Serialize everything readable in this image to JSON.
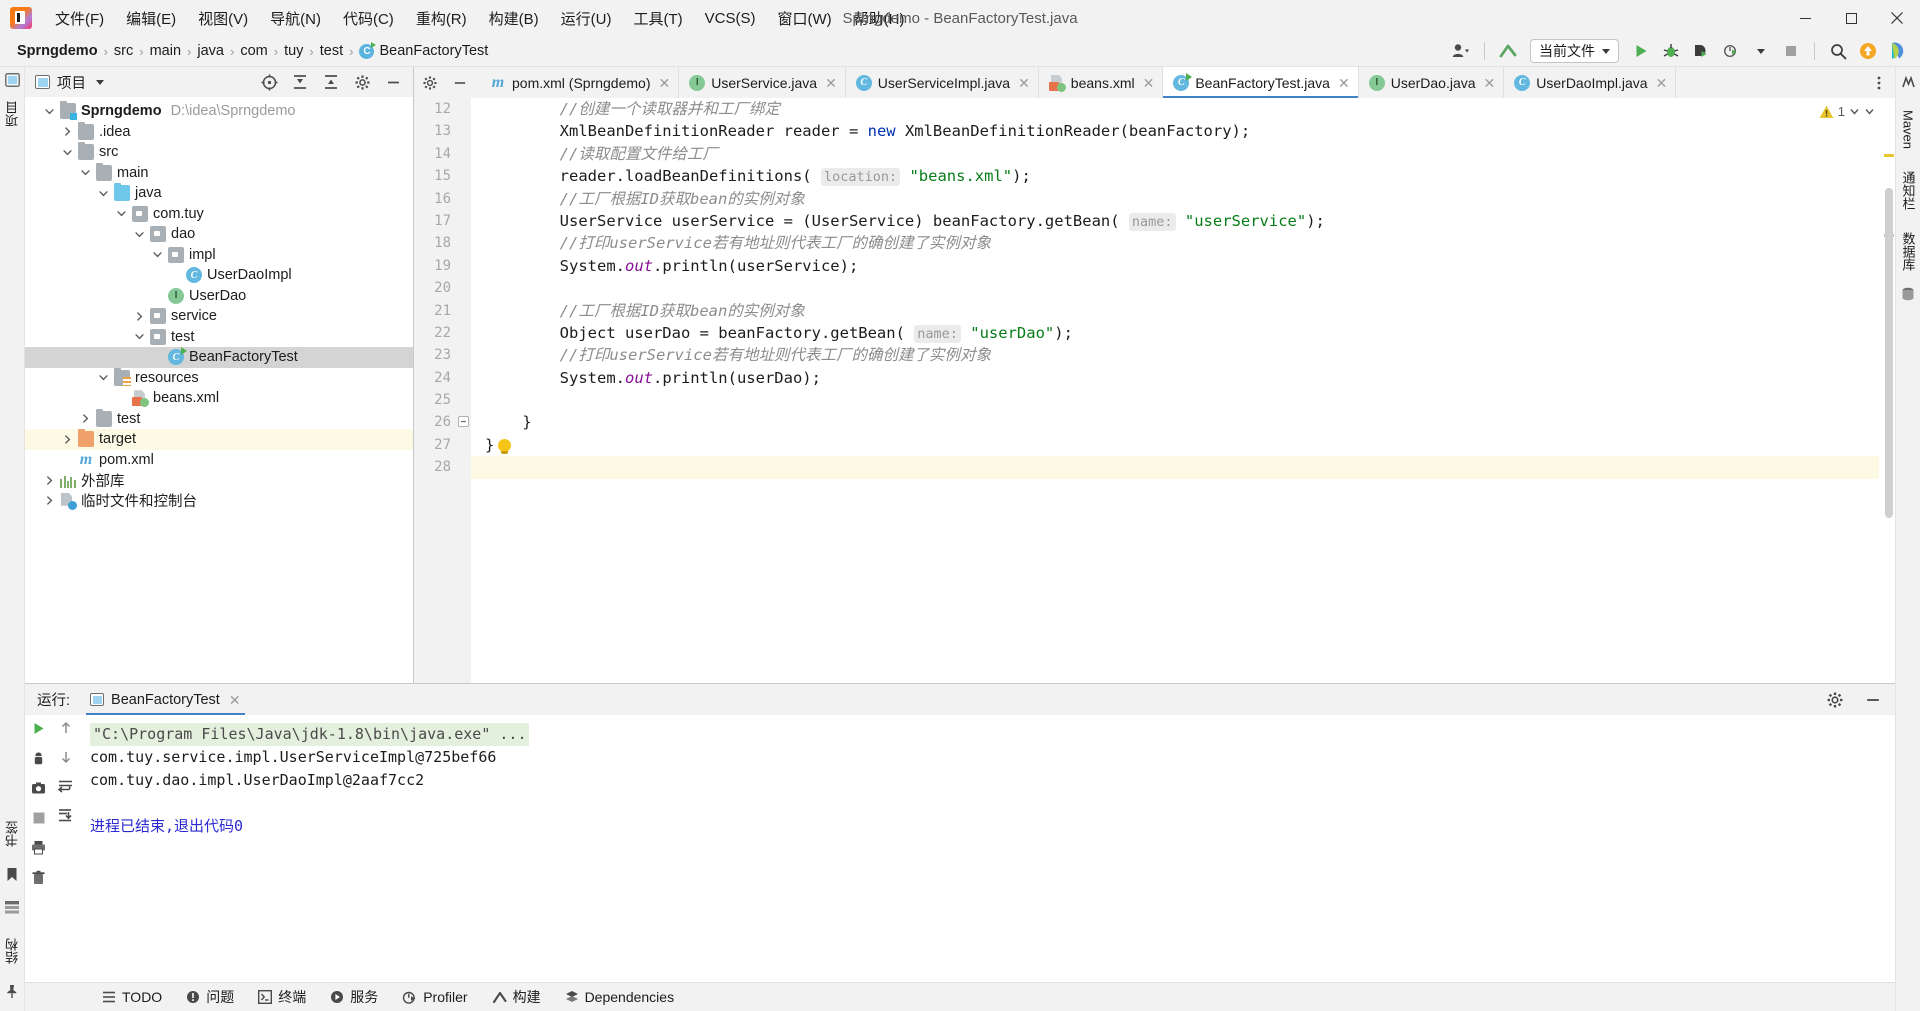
{
  "window": {
    "title": "Sprngdemo - BeanFactoryTest.java",
    "minimize": "minimize-button",
    "maximize": "maximize-button",
    "close": "close-button"
  },
  "menubar": {
    "items": [
      {
        "label": "文件(F)"
      },
      {
        "label": "编辑(E)"
      },
      {
        "label": "视图(V)"
      },
      {
        "label": "导航(N)"
      },
      {
        "label": "代码(C)"
      },
      {
        "label": "重构(R)"
      },
      {
        "label": "构建(B)"
      },
      {
        "label": "运行(U)"
      },
      {
        "label": "工具(T)"
      },
      {
        "label": "VCS(S)"
      },
      {
        "label": "窗口(W)"
      },
      {
        "label": "帮助(H)"
      }
    ]
  },
  "breadcrumb": {
    "items": [
      "Sprngdemo",
      "src",
      "main",
      "java",
      "com",
      "tuy",
      "test"
    ],
    "file": "BeanFactoryTest",
    "separator": "›"
  },
  "toolbar": {
    "run_config": "当前文件",
    "icons": [
      "user-avatar-icon",
      "updates-arrow-icon",
      "run-icon",
      "debug-icon",
      "run-coverage-icon",
      "profiler-icon",
      "stop-icon",
      "search-everywhere-icon",
      "update-project-icon",
      "ide-assistant-icon"
    ]
  },
  "project_panel": {
    "title": "项目",
    "header_icons": [
      "select-opened-file-icon",
      "expand-all-icon",
      "collapse-all-icon",
      "settings-icon",
      "hide-icon"
    ],
    "tree": [
      {
        "depth": 0,
        "label": "Sprngdemo",
        "path": "D:\\idea\\Sprngdemo",
        "icon": "module-root-icon",
        "arrow": "down",
        "bold": true
      },
      {
        "depth": 1,
        "label": ".idea",
        "icon": "folder-icon",
        "arrow": "right"
      },
      {
        "depth": 1,
        "label": "src",
        "icon": "folder-icon",
        "arrow": "down"
      },
      {
        "depth": 2,
        "label": "main",
        "icon": "folder-icon",
        "arrow": "down"
      },
      {
        "depth": 3,
        "label": "java",
        "icon": "source-folder-icon",
        "arrow": "down"
      },
      {
        "depth": 4,
        "label": "com.tuy",
        "icon": "package-icon",
        "arrow": "down"
      },
      {
        "depth": 5,
        "label": "dao",
        "icon": "package-icon",
        "arrow": "down"
      },
      {
        "depth": 6,
        "label": "impl",
        "icon": "package-icon",
        "arrow": "down"
      },
      {
        "depth": 7,
        "label": "UserDaoImpl",
        "icon": "class-icon",
        "arrow": "none"
      },
      {
        "depth": 6,
        "label": "UserDao",
        "icon": "interface-icon",
        "arrow": "none"
      },
      {
        "depth": 5,
        "label": "service",
        "icon": "package-icon",
        "arrow": "right"
      },
      {
        "depth": 5,
        "label": "test",
        "icon": "package-icon",
        "arrow": "down"
      },
      {
        "depth": 6,
        "label": "BeanFactoryTest",
        "icon": "runnable-class-icon",
        "arrow": "none",
        "selected": true
      },
      {
        "depth": 3,
        "label": "resources",
        "icon": "resources-folder-icon",
        "arrow": "down"
      },
      {
        "depth": 4,
        "label": "beans.xml",
        "icon": "spring-xml-icon",
        "arrow": "none"
      },
      {
        "depth": 2,
        "label": "test",
        "icon": "folder-icon",
        "arrow": "right"
      },
      {
        "depth": 1,
        "label": "target",
        "icon": "excluded-folder-icon",
        "arrow": "right",
        "highlight": true
      },
      {
        "depth": 1,
        "label": "pom.xml",
        "icon": "maven-icon",
        "arrow": "none"
      },
      {
        "depth": 0,
        "label": "外部库",
        "icon": "external-libraries-icon",
        "arrow": "right"
      },
      {
        "depth": 0,
        "label": "临时文件和控制台",
        "icon": "scratches-icon",
        "arrow": "right"
      }
    ]
  },
  "editor": {
    "tabs": [
      {
        "label": "pom.xml (Sprngdemo)",
        "icon": "maven-icon",
        "active": false
      },
      {
        "label": "UserService.java",
        "icon": "interface-icon",
        "active": false
      },
      {
        "label": "UserServiceImpl.java",
        "icon": "class-icon",
        "active": false
      },
      {
        "label": "beans.xml",
        "icon": "spring-xml-icon",
        "active": false
      },
      {
        "label": "BeanFactoryTest.java",
        "icon": "runnable-class-icon",
        "active": true
      },
      {
        "label": "UserDao.java",
        "icon": "interface-icon",
        "active": false
      },
      {
        "label": "UserDaoImpl.java",
        "icon": "class-icon",
        "active": false
      }
    ],
    "warning_count": "1",
    "line_numbers": [
      "12",
      "13",
      "14",
      "15",
      "16",
      "17",
      "18",
      "19",
      "20",
      "21",
      "22",
      "23",
      "24",
      "25",
      "26",
      "27",
      "28"
    ],
    "lines": [
      {
        "n": "12",
        "tokens": [
          {
            "t": "        //创建一个读取器并和工厂绑定",
            "c": "cmt"
          }
        ]
      },
      {
        "n": "13",
        "tokens": [
          {
            "t": "        XmlBeanDefinitionReader reader = ",
            "c": ""
          },
          {
            "t": "new",
            "c": "kw"
          },
          {
            "t": " XmlBeanDefinitionReader(beanFactory);",
            "c": ""
          }
        ]
      },
      {
        "n": "14",
        "tokens": [
          {
            "t": "        //读取配置文件给工厂",
            "c": "cmt"
          }
        ]
      },
      {
        "n": "15",
        "tokens": [
          {
            "t": "        reader.loadBeanDefinitions( ",
            "c": ""
          },
          {
            "t": "location:",
            "c": "hint"
          },
          {
            "t": " ",
            "c": ""
          },
          {
            "t": "\"beans.xml\"",
            "c": "str"
          },
          {
            "t": ");",
            "c": ""
          }
        ]
      },
      {
        "n": "16",
        "tokens": [
          {
            "t": "        //工厂根据ID获取bean的实例对象",
            "c": "cmt"
          }
        ]
      },
      {
        "n": "17",
        "tokens": [
          {
            "t": "        UserService userService = (UserService) beanFactory.getBean( ",
            "c": ""
          },
          {
            "t": "name:",
            "c": "hint"
          },
          {
            "t": " ",
            "c": ""
          },
          {
            "t": "\"userService\"",
            "c": "str"
          },
          {
            "t": ");",
            "c": ""
          }
        ]
      },
      {
        "n": "18",
        "tokens": [
          {
            "t": "        //打印userService若有地址则代表工厂的确创建了实例对象",
            "c": "cmt"
          }
        ]
      },
      {
        "n": "19",
        "tokens": [
          {
            "t": "        System.",
            "c": ""
          },
          {
            "t": "out",
            "c": "fld"
          },
          {
            "t": ".println(userService);",
            "c": ""
          }
        ]
      },
      {
        "n": "20",
        "tokens": [
          {
            "t": "",
            "c": ""
          }
        ]
      },
      {
        "n": "21",
        "tokens": [
          {
            "t": "        //工厂根据ID获取bean的实例对象",
            "c": "cmt"
          }
        ]
      },
      {
        "n": "22",
        "tokens": [
          {
            "t": "        Object userDao = beanFactory.getBean( ",
            "c": ""
          },
          {
            "t": "name:",
            "c": "hint"
          },
          {
            "t": " ",
            "c": ""
          },
          {
            "t": "\"userDao\"",
            "c": "str"
          },
          {
            "t": ");",
            "c": ""
          }
        ]
      },
      {
        "n": "23",
        "tokens": [
          {
            "t": "        //打印userService若有地址则代表工厂的确创建了实例对象",
            "c": "cmt"
          }
        ]
      },
      {
        "n": "24",
        "tokens": [
          {
            "t": "        System.",
            "c": ""
          },
          {
            "t": "out",
            "c": "fld"
          },
          {
            "t": ".println(userDao);",
            "c": ""
          }
        ]
      },
      {
        "n": "25",
        "tokens": [
          {
            "t": "",
            "c": ""
          }
        ]
      },
      {
        "n": "26",
        "tokens": [
          {
            "t": "    }",
            "c": ""
          }
        ]
      },
      {
        "n": "27",
        "tokens": [
          {
            "t": "}",
            "c": ""
          }
        ]
      },
      {
        "n": "28",
        "tokens": [
          {
            "t": "",
            "c": ""
          }
        ]
      }
    ]
  },
  "run_panel": {
    "label": "运行:",
    "tab": "BeanFactoryTest",
    "gutter_icons": [
      "rerun-icon",
      "stop-icon",
      "camera-icon",
      "thread-dump-icon",
      "print-icon",
      "trash-icon",
      "up-icon",
      "down-icon",
      "soft-wrap-icon",
      "scroll-to-end-icon"
    ],
    "settings_icon": "settings-icon",
    "hide_icon": "hide-icon",
    "output": [
      {
        "text": "\"C:\\Program Files\\Java\\jdk-1.8\\bin\\java.exe\" ...",
        "style": "cmd"
      },
      {
        "text": "com.tuy.service.impl.UserServiceImpl@725bef66",
        "style": "plain"
      },
      {
        "text": "com.tuy.dao.impl.UserDaoImpl@2aaf7cc2",
        "style": "plain"
      },
      {
        "text": "",
        "style": "plain"
      },
      {
        "text": "进程已结束,退出代码0",
        "style": "exit"
      }
    ]
  },
  "sidebars": {
    "left_top": "项目",
    "left_bottom": [
      "书签",
      "结构"
    ],
    "right": [
      "Maven",
      "通知栏",
      "数据库"
    ]
  },
  "statusbar": {
    "tools": [
      {
        "label": "TODO",
        "icon": "todo-icon"
      },
      {
        "label": "问题",
        "icon": "problems-icon"
      },
      {
        "label": "终端",
        "icon": "terminal-icon"
      },
      {
        "label": "服务",
        "icon": "services-icon"
      },
      {
        "label": "Profiler",
        "icon": "profiler-icon"
      },
      {
        "label": "构建",
        "icon": "build-icon"
      },
      {
        "label": "Dependencies",
        "icon": "dependencies-icon"
      }
    ]
  },
  "colors": {
    "accent": "#4083c9",
    "keyword": "#0033b3",
    "string": "#067d17",
    "comment": "#8c8c8c",
    "field": "#871094",
    "selection": "#d4d4d4",
    "highlight": "#fcfae4",
    "console_cmd_bg": "#e3f0dd",
    "exit_text": "#2a2ad0"
  }
}
